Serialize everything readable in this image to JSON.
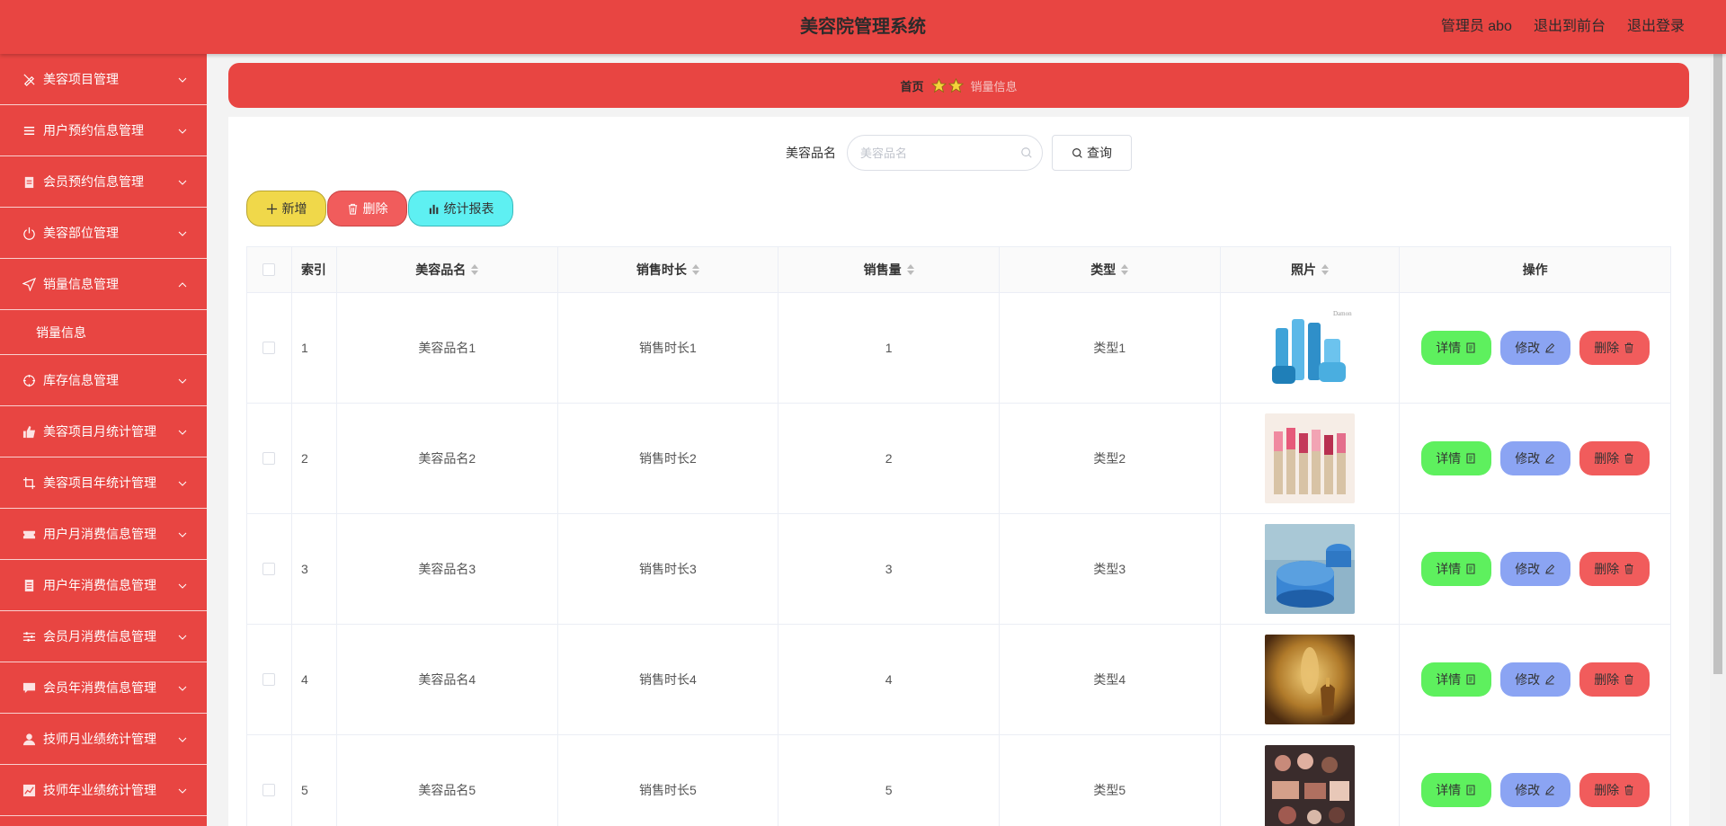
{
  "header": {
    "title": "美容院管理系统",
    "user_label": "管理员 abo",
    "to_front": "退出到前台",
    "logout": "退出登录"
  },
  "sidebar": {
    "items": [
      {
        "label": "美容项目管理",
        "icon": "pen-off-icon"
      },
      {
        "label": "用户预约信息管理",
        "icon": "list-icon"
      },
      {
        "label": "会员预约信息管理",
        "icon": "clipboard-icon"
      },
      {
        "label": "美容部位管理",
        "icon": "power-icon"
      },
      {
        "label": "销量信息管理",
        "icon": "send-icon",
        "expanded": true
      },
      {
        "label": "库存信息管理",
        "icon": "crosshair-icon"
      },
      {
        "label": "美容项目月统计管理",
        "icon": "thumbs-up-icon"
      },
      {
        "label": "美容项目年统计管理",
        "icon": "crop-icon"
      },
      {
        "label": "用户月消费信息管理",
        "icon": "ticket-icon"
      },
      {
        "label": "用户年消费信息管理",
        "icon": "document-icon"
      },
      {
        "label": "会员月消费信息管理",
        "icon": "sliders-icon"
      },
      {
        "label": "会员年消费信息管理",
        "icon": "chat-icon"
      },
      {
        "label": "技师月业绩统计管理",
        "icon": "user-icon"
      },
      {
        "label": "技师年业绩统计管理",
        "icon": "chart-icon"
      }
    ],
    "sub_item": "销量信息"
  },
  "breadcrumb": {
    "home": "首页",
    "current": "销量信息"
  },
  "search": {
    "label": "美容品名",
    "placeholder": "美容品名",
    "query_button": "查询"
  },
  "actions": {
    "add": "新增",
    "delete": "删除",
    "stats": "统计报表"
  },
  "table": {
    "headers": {
      "index": "索引",
      "name": "美容品名",
      "duration": "销售时长",
      "volume": "销售量",
      "type": "类型",
      "photo": "照片",
      "ops": "操作"
    },
    "rows": [
      {
        "index": "1",
        "name": "美容品名1",
        "duration": "销售时长1",
        "volume": "1",
        "type": "类型1",
        "photo": "blue-skincare-bottles"
      },
      {
        "index": "2",
        "name": "美容品名2",
        "duration": "销售时长2",
        "volume": "2",
        "type": "类型2",
        "photo": "lipsticks"
      },
      {
        "index": "3",
        "name": "美容品名3",
        "duration": "销售时长3",
        "volume": "3",
        "type": "类型3",
        "photo": "blue-cream-jar"
      },
      {
        "index": "4",
        "name": "美容品名4",
        "duration": "销售时长4",
        "volume": "4",
        "type": "类型4",
        "photo": "gold-perfume"
      },
      {
        "index": "5",
        "name": "美容品名5",
        "duration": "销售时长5",
        "volume": "5",
        "type": "类型5",
        "photo": "makeup-palette"
      }
    ],
    "row_actions": {
      "detail": "详情",
      "edit": "修改",
      "delete": "删除"
    }
  },
  "colors": {
    "primary": "#e84542",
    "detail_btn": "#5ef05e",
    "edit_btn": "#8ba4f3",
    "delete_btn": "#f15c5c",
    "add_btn": "#f0d84a",
    "stats_btn": "#5ef0f2"
  }
}
